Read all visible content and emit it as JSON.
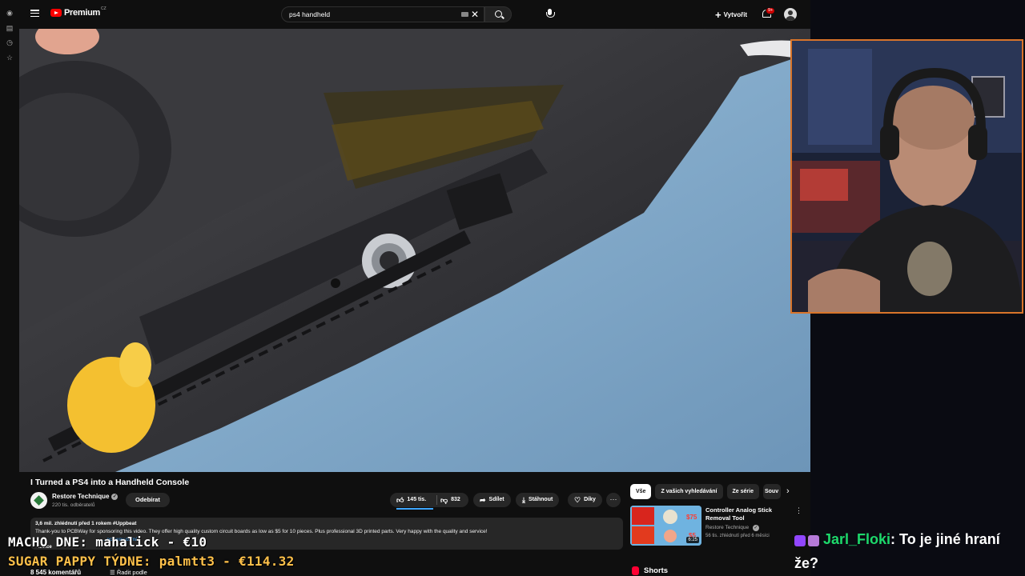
{
  "youtube": {
    "logo_word": "Premium",
    "logo_region": "CZ",
    "search_query": "ps4 handheld",
    "create_label": "Vytvořit",
    "notifications_badge": "9+",
    "video_title": "I Turned a PS4 into a Handheld Console",
    "channel_name": "Restore Technique",
    "subscribers": "220 tis. odběratelů",
    "subscribe_label": "Odebírat",
    "like_count": "145 tis.",
    "dislike_count": "832",
    "share_label": "Sdílet",
    "download_label": "Stáhnout",
    "thanks_label": "Díky",
    "like_ratio": 0.99,
    "description_stats": "3,6 mil. zhlédnutí  před 1 rokem  #Uppbeat",
    "description_text": "Thank-you to PCBWay for sponsoring this video. They offer high quality custom circuit boards as low as $5 for 10 pieces. Plus professional 3D printed parts. Very happy with the quality and service!",
    "description_link": "...pcbway.com/...",
    "description_more": "...více",
    "comments_count": "8 545 komentářů",
    "sort_label": "Řadit podle",
    "chips": [
      "Vše",
      "Z vašich vyhledávání",
      "Ze série",
      "Souv"
    ],
    "recommendation": {
      "title": "Controller Analog Stick Removal Tool",
      "channel": "Restore Technique",
      "meta": "56 tis. zhlédnutí  před 6 měsíci",
      "duration": "6:25",
      "price_top": "$75",
      "price_bottom": "$5"
    },
    "shorts_label": "Shorts"
  },
  "stream_overlay": {
    "line1": "MACHO DNE: mahalick - €10",
    "line2": "SUGAR PAPPY TÝDNE: palmtt3 - €114.32"
  },
  "chat": {
    "username": "Jarl_Floki",
    "message": ": To je jiné hraní že?"
  },
  "colors": {
    "accent_red": "#ff0000",
    "cam_border": "#d8742a",
    "chat_username": "#1dd96b",
    "overlay_gold": "#ffc14a"
  }
}
